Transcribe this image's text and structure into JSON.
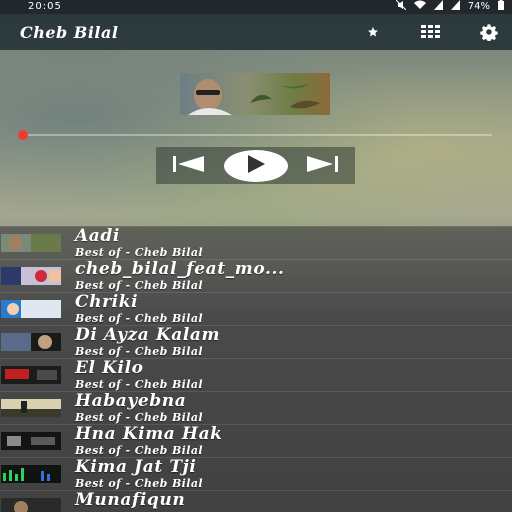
{
  "status_bar": {
    "time": "20:05",
    "battery": "74%",
    "icons": [
      "mute-icon",
      "wifi-icon",
      "signal-icon",
      "signal-icon",
      "battery-icon"
    ]
  },
  "toolbar": {
    "title": "Cheb Bilal",
    "icons": [
      "star-icon",
      "grid-icon",
      "gear-icon"
    ]
  },
  "player": {
    "progress_fraction": 0.0,
    "accent_color": "#f43a2c",
    "controls": [
      "previous-icon",
      "play-icon",
      "next-icon"
    ]
  },
  "tracks": [
    {
      "title": "Aadi",
      "artist": "Best of - Cheb Bilal"
    },
    {
      "title": "cheb_bilal_feat_mo...",
      "artist": "Best of - Cheb Bilal"
    },
    {
      "title": "Chriki",
      "artist": "Best of - Cheb Bilal"
    },
    {
      "title": "Di Ayza Kalam",
      "artist": "Best of - Cheb Bilal"
    },
    {
      "title": "El Kilo",
      "artist": "Best of - Cheb Bilal"
    },
    {
      "title": "Habayebna",
      "artist": "Best of - Cheb Bilal"
    },
    {
      "title": "Hna Kima Hak",
      "artist": "Best of - Cheb Bilal"
    },
    {
      "title": "Kima Jat Tji",
      "artist": "Best of - Cheb Bilal"
    },
    {
      "title": "Munafiqun",
      "artist": ""
    }
  ]
}
